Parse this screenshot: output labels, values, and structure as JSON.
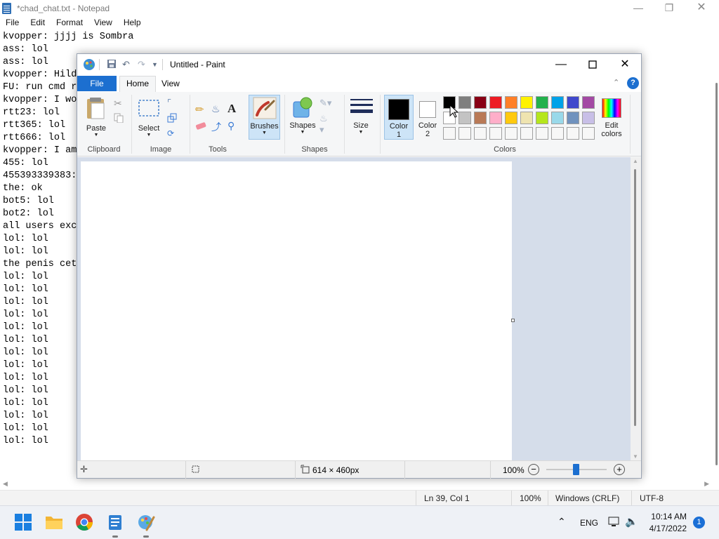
{
  "notepad": {
    "title": "*chad_chat.txt - Notepad",
    "menu": [
      "File",
      "Edit",
      "Format",
      "View",
      "Help"
    ],
    "lines": [
      "kvopper: jjjj is Sombra",
      "ass: lol",
      "ass: lol",
      "kvopper: Hild",
      "FU: run cmd r",
      "kvopper: I wo",
      "rtt23: lol",
      "rtt365: lol",
      "rtt666: lol",
      "kvopper: I am",
      "455: lol",
      "455393339383:",
      "the: ok",
      "bot5: lol",
      "bot2: lol",
      "all users exc",
      "lol: lol",
      "lol: lol",
      "the penis cet",
      "lol: lol",
      "lol: lol",
      "lol: lol",
      "lol: lol",
      "lol: lol",
      "lol: lol",
      "lol: lol",
      "lol: lol",
      "lol: lol",
      "lol: lol",
      "lol: lol",
      "lol: lol",
      "lol: lol",
      "lol: lol"
    ],
    "status": {
      "position": "Ln 39, Col 1",
      "zoom": "100%",
      "line_ending": "Windows (CRLF)",
      "encoding": "UTF-8"
    }
  },
  "paint": {
    "title": "Untitled - Paint",
    "tabs": {
      "file": "File",
      "home": "Home",
      "view": "View"
    },
    "ribbon": {
      "paste": "Paste",
      "select": "Select",
      "brushes": "Brushes",
      "shapes": "Shapes",
      "size": "Size",
      "color1": "Color\n1",
      "color1_a": "Color",
      "color1_b": "1",
      "color2_a": "Color",
      "color2_b": "2",
      "edit_colors_a": "Edit",
      "edit_colors_b": "colors",
      "groups": {
        "clipboard": "Clipboard",
        "image": "Image",
        "tools": "Tools",
        "shapes": "Shapes",
        "colors": "Colors"
      }
    },
    "palette_row1": [
      "#000000",
      "#7f7f7f",
      "#880015",
      "#ed1c24",
      "#ff7f27",
      "#fff200",
      "#22b14c",
      "#00a2e8",
      "#3f48cc",
      "#a349a4"
    ],
    "palette_row2": [
      "#ffffff",
      "#c3c3c3",
      "#b97a57",
      "#ffaec9",
      "#ffc90e",
      "#efe4b0",
      "#b5e61d",
      "#99d9ea",
      "#7092be",
      "#c8bfe7"
    ],
    "status": {
      "canvas_size": "614 × 460px",
      "zoom": "100%"
    }
  },
  "taskbar": {
    "time": "10:14 AM",
    "date": "4/17/2022",
    "language": "ENG",
    "notifications": "1"
  }
}
